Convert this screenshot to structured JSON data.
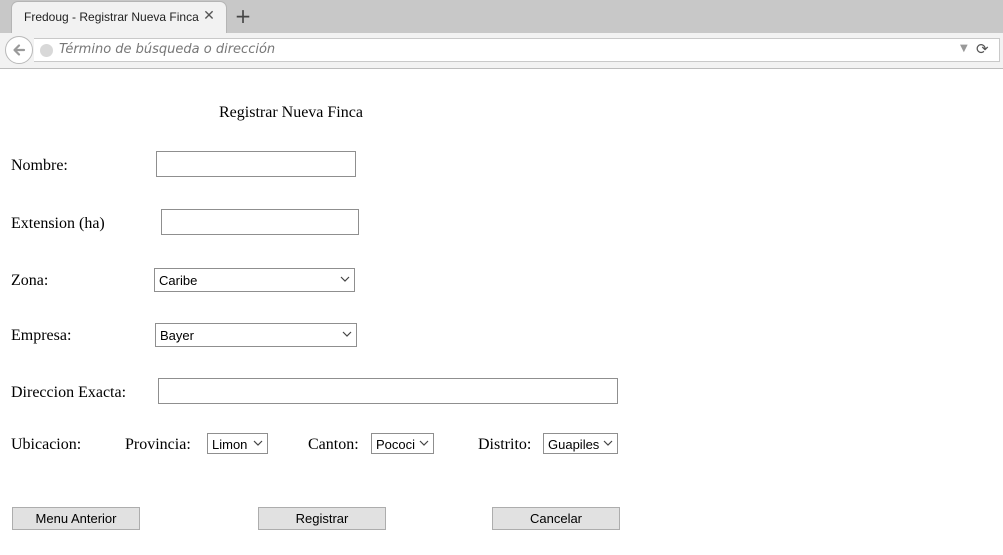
{
  "browser": {
    "tab_title": "Fredoug - Registrar Nueva Finca",
    "tab_close": "✕",
    "new_tab": "+",
    "url_placeholder": "Término de búsqueda o dirección",
    "icons": [
      "back-arrow-icon",
      "globe-icon",
      "dropdown-arrow-icon",
      "reload-icon"
    ]
  },
  "form": {
    "title": "Registrar Nueva Finca",
    "nombre": {
      "label": "Nombre:",
      "value": ""
    },
    "extension": {
      "label": "Extension (ha)",
      "value": ""
    },
    "zona": {
      "label": "Zona:",
      "selected": "Caribe"
    },
    "empresa": {
      "label": "Empresa:",
      "selected": "Bayer"
    },
    "direccion": {
      "label": "Direccion Exacta:",
      "value": ""
    },
    "ubicacion": {
      "label": "Ubicacion:",
      "provincia": {
        "label": "Provincia:",
        "selected": "Limon"
      },
      "canton": {
        "label": "Canton:",
        "selected": "Pococi"
      },
      "distrito": {
        "label": "Distrito:",
        "selected": "Guapiles"
      }
    },
    "buttons": {
      "menu_anterior": "Menu Anterior",
      "registrar": "Registrar",
      "cancelar": "Cancelar"
    }
  }
}
